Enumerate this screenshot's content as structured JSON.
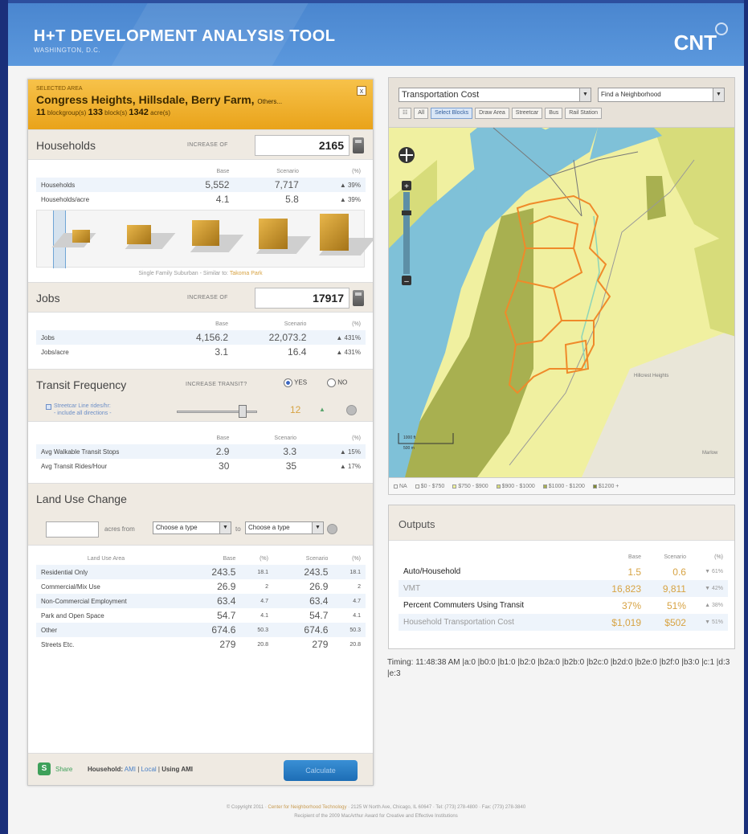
{
  "header": {
    "title": "H+T DEVELOPMENT ANALYSIS TOOL",
    "subtitle": "WASHINGTON, D.C.",
    "brand": "CNT"
  },
  "area": {
    "label": "SELECTED AREA",
    "name": "Congress Heights, Hillsdale, Berry Farm,",
    "others": "Others...",
    "blockgroups_count": "11",
    "blockgroups_label": "blockgroup(s)",
    "blocks_count": "133",
    "blocks_label": "block(s)",
    "acres_count": "1342",
    "acres_label": "acre(s)",
    "close": "x"
  },
  "households": {
    "title": "Households",
    "increase_label": "INCREASE OF",
    "increase_value": "2165",
    "col_base": "Base",
    "col_scenario": "Scenario",
    "col_pct": "(%)",
    "rows": [
      {
        "label": "Households",
        "base": "5,552",
        "scenario": "7,717",
        "pct": "▲ 39%"
      },
      {
        "label": "Households/acre",
        "base": "4.1",
        "scenario": "5.8",
        "pct": "▲ 39%"
      }
    ],
    "caption_prefix": "Single Family Suburban - Similar to:",
    "caption_link": "Takoma Park"
  },
  "jobs": {
    "title": "Jobs",
    "increase_label": "INCREASE OF",
    "increase_value": "17917",
    "col_base": "Base",
    "col_scenario": "Scenario",
    "col_pct": "(%)",
    "rows": [
      {
        "label": "Jobs",
        "base": "4,156.2",
        "scenario": "22,073.2",
        "pct": "▲ 431%"
      },
      {
        "label": "Jobs/acre",
        "base": "3.1",
        "scenario": "16.4",
        "pct": "▲ 431%"
      }
    ]
  },
  "transit": {
    "title": "Transit Frequency",
    "increase_label": "INCREASE TRANSIT?",
    "yes": "YES",
    "no": "NO",
    "rides_label": "Streetcar Line rides/hr:",
    "rides_sub": "- include all directions -",
    "rides_value": "12",
    "rides_arrow": "▲",
    "col_base": "Base",
    "col_scenario": "Scenario",
    "col_pct": "(%)",
    "rows": [
      {
        "label": "Avg Walkable Transit Stops",
        "base": "2.9",
        "scenario": "3.3",
        "pct": "▲ 15%"
      },
      {
        "label": "Avg Transit Rides/Hour",
        "base": "30",
        "scenario": "35",
        "pct": "▲ 17%"
      }
    ]
  },
  "landuse": {
    "title": "Land Use Change",
    "from_label": "acres from",
    "to_label": "to",
    "from_select": "Choose a type",
    "to_select": "Choose a type",
    "col_area": "Land Use Area",
    "col_base": "Base",
    "col_pct": "(%)",
    "col_scenario": "Scenario",
    "col_pct2": "(%)",
    "rows": [
      {
        "label": "Residential Only",
        "base": "243.5",
        "pct": "18.1",
        "scenario": "243.5",
        "pct2": "18.1"
      },
      {
        "label": "Commercial/Mix Use",
        "base": "26.9",
        "pct": "2",
        "scenario": "26.9",
        "pct2": "2"
      },
      {
        "label": "Non-Commercial Employment",
        "base": "63.4",
        "pct": "4.7",
        "scenario": "63.4",
        "pct2": "4.7"
      },
      {
        "label": "Park and Open Space",
        "base": "54.7",
        "pct": "4.1",
        "scenario": "54.7",
        "pct2": "4.1"
      },
      {
        "label": "Other",
        "base": "674.6",
        "pct": "50.3",
        "scenario": "674.6",
        "pct2": "50.3"
      },
      {
        "label": "Streets Etc.",
        "base": "279",
        "pct": "20.8",
        "scenario": "279",
        "pct2": "20.8"
      }
    ]
  },
  "bottom": {
    "share": "Share",
    "household_prefix": "Household:",
    "ami": "AMI",
    "local": "Local",
    "using": "Using AMI",
    "calculate": "Calculate"
  },
  "map": {
    "layer_select": "Transportation Cost",
    "find_select": "Find a Neighborhood",
    "tools": [
      "All",
      "Select Blocks",
      "Draw Area",
      "Streetcar",
      "Bus",
      "Rail Station"
    ],
    "first_tool": "☷",
    "scale_top": "1000 ft",
    "scale_bottom": "500 m",
    "label_heights": "Hillcrest Heights",
    "label_marlow": "Marlow",
    "legend": [
      "NA",
      "$0 - $750",
      "$750 - $900",
      "$900 - $1000",
      "$1000 - $1200",
      "$1200 +"
    ],
    "legend_colors": [
      "#ffffff",
      "#fffff2",
      "#f0f59a",
      "#d7dc7a",
      "#a8b050",
      "#7f8a30"
    ]
  },
  "outputs": {
    "title": "Outputs",
    "col_base": "Base",
    "col_scenario": "Scenario",
    "col_pct": "(%)",
    "rows": [
      {
        "label": "Auto/Household",
        "base": "1.5",
        "scenario": "0.6",
        "pct": "▼ 61%"
      },
      {
        "label": "VMT",
        "base": "16,823",
        "scenario": "9,811",
        "pct": "▼ 42%"
      },
      {
        "label": "Percent Commuters Using Transit",
        "base": "37%",
        "scenario": "51%",
        "pct": "▲ 38%"
      },
      {
        "label": "Household Transportation Cost",
        "base": "$1,019",
        "scenario": "$502",
        "pct": "▼ 51%"
      }
    ]
  },
  "timing": "Timing: 11:48:38 AM |a:0 |b0:0 |b1:0 |b2:0 |b2a:0 |b2b:0 |b2c:0 |b2d:0 |b2e:0 |b2f:0 |b3:0 |c:1 |d:3 |e:3",
  "footer": {
    "line1_prefix": "© Copyright 2011 ·",
    "line1_link": "Center for Neighborhood Technology",
    "line1_suffix": "· 2125 W North Ave, Chicago, IL 60647 · Tel: (773) 278-4800 · Fax: (773) 278-3840",
    "line2": "Recipient of the 2009 MacArthur Award for Creative and Effective Institutions"
  }
}
